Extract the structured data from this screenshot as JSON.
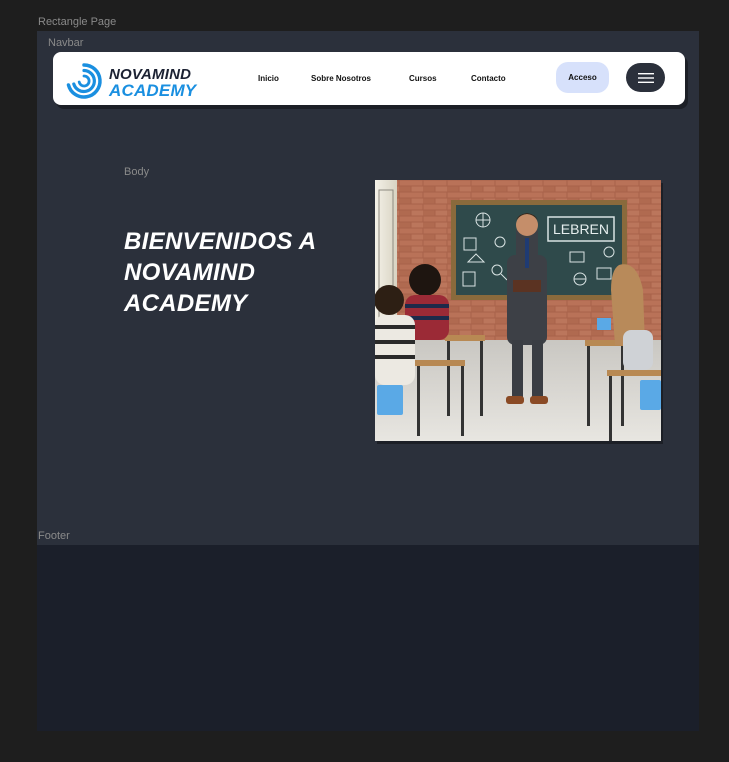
{
  "canvas_labels": {
    "page": "Rectangle Page",
    "navbar": "Navbar",
    "body": "Body",
    "footer": "Footer"
  },
  "navbar": {
    "logo": {
      "line1": "NOVAMIND",
      "line2": "ACADEMY"
    },
    "links": [
      "Inicio",
      "Sobre Nosotros",
      "Cursos",
      "Contacto"
    ],
    "login_button": "Acceso",
    "menu_icon": "hamburger-icon"
  },
  "hero": {
    "title": "BIENVENIDOS A NOVAMIND ACADEMY",
    "image": {
      "blackboard_text": "LEBREN"
    }
  },
  "colors": {
    "canvas": "#1e1e1e",
    "page_bg": "#2b303b",
    "footer_bg": "#1b1f2a",
    "navbar_bg": "#ffffff",
    "brand_blue": "#1a8fe0",
    "brand_dark": "#1c2233",
    "login_button_bg": "#d7e1fb",
    "menu_button_bg": "#2b303b"
  }
}
